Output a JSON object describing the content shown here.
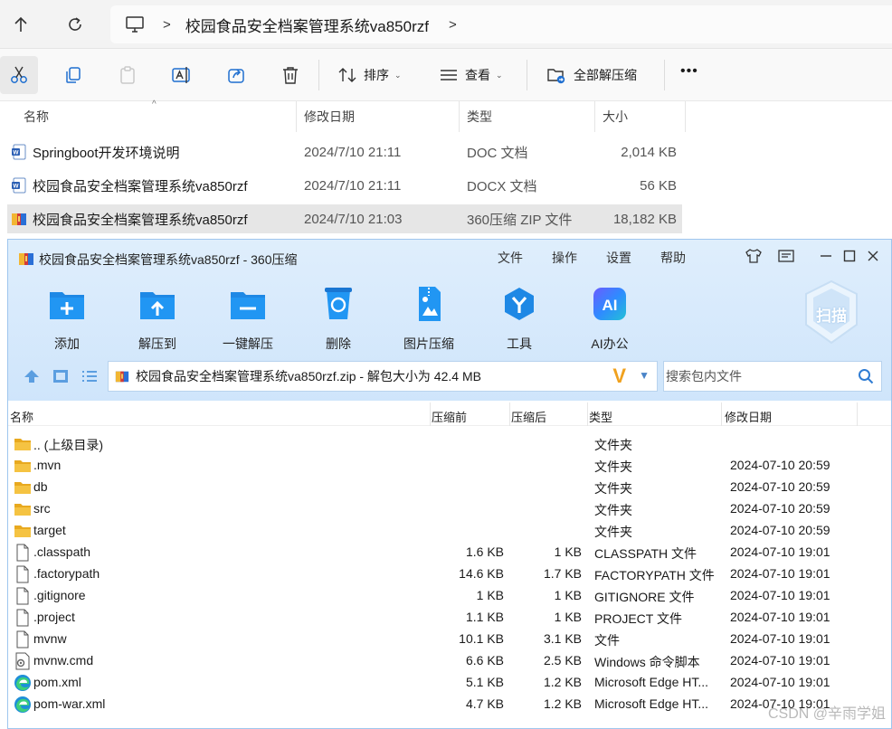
{
  "address_bar": {
    "breadcrumb": "校园食品安全档案管理系统va850rzf",
    "separator": ">"
  },
  "toolbar": {
    "sort_label": "排序",
    "view_label": "查看",
    "extract_all_label": "全部解压缩",
    "more_label": "•••"
  },
  "explorer_list": {
    "columns": [
      "名称",
      "修改日期",
      "类型",
      "大小"
    ],
    "rows": [
      {
        "name": "Springboot开发环境说明",
        "date": "2024/7/10 21:11",
        "type": "DOC 文档",
        "size": "2,014 KB",
        "icon": "word-doc-icon"
      },
      {
        "name": "校园食品安全档案管理系统va850rzf",
        "date": "2024/7/10 21:11",
        "type": "DOCX 文档",
        "size": "56 KB",
        "icon": "word-doc-icon"
      },
      {
        "name": "校园食品安全档案管理系统va850rzf",
        "date": "2024/7/10 21:03",
        "type": "360压缩 ZIP 文件",
        "size": "18,182 KB",
        "icon": "zip-archive-icon"
      }
    ]
  },
  "zip_window": {
    "title": "校园食品安全档案管理系统va850rzf - 360压缩",
    "menu": [
      "文件",
      "操作",
      "设置",
      "帮助"
    ],
    "tools": [
      "添加",
      "解压到",
      "一键解压",
      "删除",
      "图片压缩",
      "工具",
      "AI办公"
    ],
    "scan_label": "扫描",
    "path": "校园食品安全档案管理系统va850rzf.zip - 解包大小为 42.4 MB",
    "search_placeholder": "搜索包内文件",
    "columns": [
      "名称",
      "压缩前",
      "压缩后",
      "类型",
      "修改日期"
    ],
    "rows": [
      {
        "name": ".. (上级目录)",
        "before": "",
        "after": "",
        "type": "文件夹",
        "date": "",
        "icon": "folder-icon"
      },
      {
        "name": ".mvn",
        "before": "",
        "after": "",
        "type": "文件夹",
        "date": "2024-07-10 20:59",
        "icon": "folder-icon"
      },
      {
        "name": "db",
        "before": "",
        "after": "",
        "type": "文件夹",
        "date": "2024-07-10 20:59",
        "icon": "folder-icon"
      },
      {
        "name": "src",
        "before": "",
        "after": "",
        "type": "文件夹",
        "date": "2024-07-10 20:59",
        "icon": "folder-icon"
      },
      {
        "name": "target",
        "before": "",
        "after": "",
        "type": "文件夹",
        "date": "2024-07-10 20:59",
        "icon": "folder-icon"
      },
      {
        "name": ".classpath",
        "before": "1.6 KB",
        "after": "1 KB",
        "type": "CLASSPATH 文件",
        "date": "2024-07-10 19:01",
        "icon": "file-icon"
      },
      {
        "name": ".factorypath",
        "before": "14.6 KB",
        "after": "1.7 KB",
        "type": "FACTORYPATH 文件",
        "date": "2024-07-10 19:01",
        "icon": "file-icon"
      },
      {
        "name": ".gitignore",
        "before": "1 KB",
        "after": "1 KB",
        "type": "GITIGNORE 文件",
        "date": "2024-07-10 19:01",
        "icon": "file-icon"
      },
      {
        "name": ".project",
        "before": "1.1 KB",
        "after": "1 KB",
        "type": "PROJECT 文件",
        "date": "2024-07-10 19:01",
        "icon": "file-icon"
      },
      {
        "name": "mvnw",
        "before": "10.1 KB",
        "after": "3.1 KB",
        "type": "文件",
        "date": "2024-07-10 19:01",
        "icon": "file-icon"
      },
      {
        "name": "mvnw.cmd",
        "before": "6.6 KB",
        "after": "2.5 KB",
        "type": "Windows 命令脚本",
        "date": "2024-07-10 19:01",
        "icon": "cmd-script-icon"
      },
      {
        "name": "pom.xml",
        "before": "5.1 KB",
        "after": "1.2 KB",
        "type": "Microsoft Edge HT...",
        "date": "2024-07-10 19:01",
        "icon": "edge-icon"
      },
      {
        "name": "pom-war.xml",
        "before": "4.7 KB",
        "after": "1.2 KB",
        "type": "Microsoft Edge HT...",
        "date": "2024-07-10 19:01",
        "icon": "edge-icon"
      }
    ]
  },
  "watermark": "CSDN @辛雨学姐",
  "colors": {
    "zip_header_bg": "#cfe5fb",
    "tool_icon_blue": "#1e88e5",
    "folder_yellow": "#f5c342",
    "selection_bg": "#e6e6e6"
  }
}
